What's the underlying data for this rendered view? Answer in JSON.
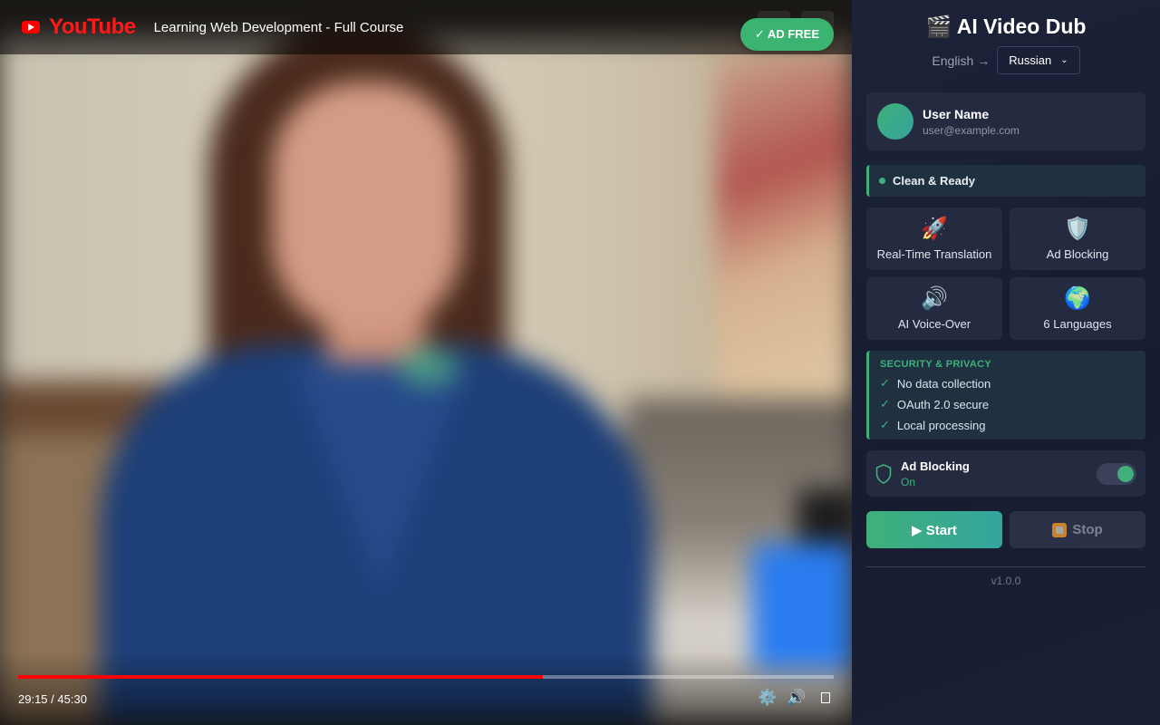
{
  "video": {
    "brand": "YouTube",
    "title": "Learning Web Development - Full Course",
    "ad_free_badge": "✓ AD FREE",
    "current_time": "29:15",
    "duration": "45:30",
    "progress_fraction": 0.643,
    "icons": [
      "youtube-play-icon",
      "settings-icon",
      "volume-icon",
      "fullscreen-icon"
    ]
  },
  "panel": {
    "title": "🎬 AI Video Dub",
    "language_from": "English →",
    "language_to": "Russian",
    "user": {
      "name": "User Name",
      "email": "user@example.com"
    },
    "status": "Clean & Ready",
    "features": [
      {
        "icon": "🚀",
        "label": "Real-Time Translation"
      },
      {
        "icon": "🛡️",
        "label": "Ad Blocking"
      },
      {
        "icon": "🔊",
        "label": "AI Voice-Over"
      },
      {
        "icon": "🌍",
        "label": "6 Languages"
      }
    ],
    "security": {
      "title": "SECURITY & PRIVACY",
      "items": [
        "No data collection",
        "OAuth 2.0 secure",
        "Local processing"
      ]
    },
    "ad_blocking": {
      "name": "Ad Blocking",
      "state": "On",
      "enabled": true
    },
    "start_label": "▶ Start",
    "stop_label": "Stop",
    "version": "v1.0.0"
  },
  "colors": {
    "accent": "#3fb07a",
    "youtube_red": "#ff0000",
    "panel_bg": "#1c2238"
  }
}
